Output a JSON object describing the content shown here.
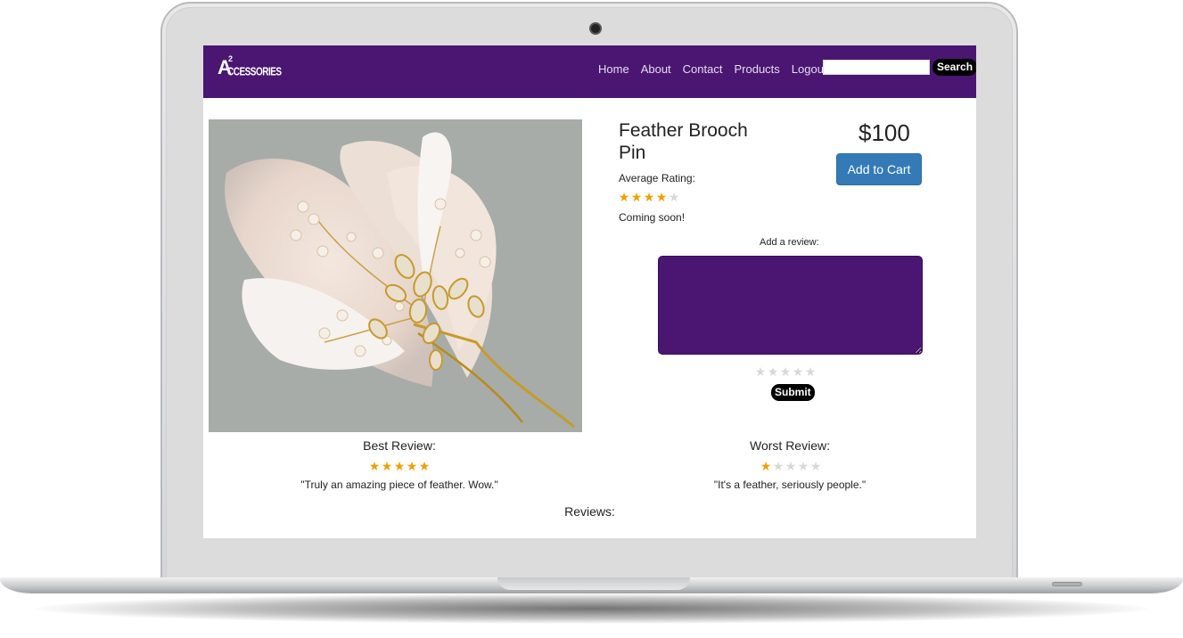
{
  "brand": {
    "logo_letter": "A",
    "logo_sup": "2",
    "logo_text": "CCESSORIES"
  },
  "nav": {
    "items": [
      {
        "label": "Home"
      },
      {
        "label": "About"
      },
      {
        "label": "Contact"
      },
      {
        "label": "Products"
      },
      {
        "label": "Logout"
      }
    ],
    "search_value": "",
    "search_button": "Search"
  },
  "product": {
    "title": "Feather Brooch Pin",
    "price": "$100",
    "add_to_cart": "Add to Cart",
    "average_rating_label": "Average Rating:",
    "average_rating": 4,
    "max_rating": 5,
    "description": "Coming soon!",
    "image_alt": "feather brooch pin photo"
  },
  "review_form": {
    "label": "Add a review:",
    "value": "",
    "rating": 0,
    "submit_label": "Submit"
  },
  "best_review": {
    "title": "Best Review:",
    "rating": 5,
    "quote": "\"Truly an amazing piece of feather. Wow.\""
  },
  "worst_review": {
    "title": "Worst Review:",
    "rating": 1,
    "quote": "\"It's a feather, seriously people.\""
  },
  "reviews_section": {
    "title": "Reviews:"
  },
  "colors": {
    "brand_purple": "#4a1672",
    "star_on": "#f0a000",
    "star_off": "#d8d8d8",
    "primary_button": "#337ab7"
  }
}
